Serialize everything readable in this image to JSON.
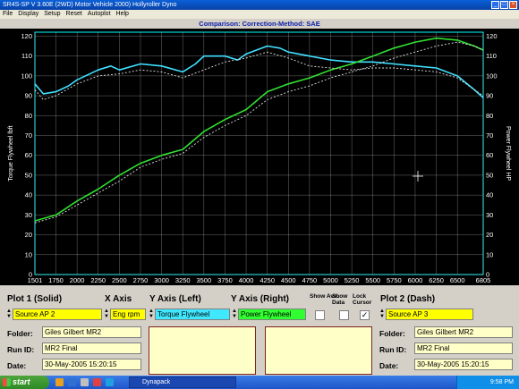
{
  "window": {
    "title": "SR4S-SP V 3.60E  (2WD)  Motor Vehicle 2000)  Hollyroller Dyno",
    "controls": [
      "_",
      "□",
      "×"
    ]
  },
  "menu": [
    "File",
    "Display",
    "Setup",
    "Reset",
    "Autoplot",
    "Help"
  ],
  "comparison_banner": "Comparison:    Correction-Method: SAE",
  "chart_data": {
    "type": "line",
    "xlabel": "",
    "ylabel_left": "Torque Flywheel lbft",
    "ylabel_right": "Power Flywheel HP",
    "x_ticks": [
      "1501",
      "1750",
      "2000",
      "2250",
      "2500",
      "2750",
      "3000",
      "3250",
      "3500",
      "3750",
      "4000",
      "4250",
      "4500",
      "4750",
      "5000",
      "5250",
      "5500",
      "5750",
      "6000",
      "6250",
      "6500",
      "6805"
    ],
    "y_ticks": [
      0,
      10,
      20,
      30,
      40,
      50,
      60,
      70,
      80,
      90,
      100,
      110,
      120
    ],
    "xlim": [
      1501,
      6805
    ],
    "ylim": [
      0,
      122
    ],
    "grid": true,
    "colors": {
      "torque": "#40e0ff",
      "power": "#30e030",
      "dash": "#e0e0e0",
      "grid": "#c8c8c8",
      "axis_frame": "#00ffff"
    },
    "series": [
      {
        "name": "Torque Flywheel",
        "style": "solid",
        "x": [
          1501,
          1600,
          1750,
          1900,
          2000,
          2250,
          2400,
          2500,
          2750,
          3000,
          3250,
          3400,
          3500,
          3750,
          3900,
          4000,
          4250,
          4400,
          4500,
          4750,
          5000,
          5250,
          5500,
          5750,
          6000,
          6250,
          6500,
          6700,
          6805
        ],
        "y": [
          96,
          91,
          92,
          95,
          98,
          103,
          105,
          103,
          106,
          105,
          102,
          106,
          110,
          110,
          108,
          111,
          115,
          114,
          112,
          110,
          108,
          107,
          107,
          106,
          105,
          104,
          100,
          93,
          89
        ]
      },
      {
        "name": "Power Flywheel",
        "style": "solid",
        "x": [
          1501,
          1750,
          2000,
          2250,
          2500,
          2750,
          3000,
          3250,
          3500,
          3750,
          4000,
          4250,
          4500,
          4750,
          5000,
          5250,
          5500,
          5750,
          6000,
          6250,
          6500,
          6700,
          6805
        ],
        "y": [
          27,
          30,
          37,
          43,
          50,
          56,
          60,
          63,
          72,
          78,
          83,
          92,
          96,
          99,
          103,
          106,
          110,
          114,
          117,
          119,
          118,
          115,
          113
        ]
      },
      {
        "name": "Torque Flywheel (Plot 2)",
        "style": "dash",
        "x": [
          1501,
          1600,
          1750,
          2000,
          2250,
          2500,
          2750,
          3000,
          3250,
          3500,
          3750,
          4000,
          4250,
          4500,
          4750,
          5000,
          5250,
          5500,
          5750,
          6000,
          6250,
          6500,
          6700,
          6805
        ],
        "y": [
          93,
          88,
          90,
          96,
          100,
          101,
          103,
          102,
          99,
          103,
          107,
          109,
          112,
          109,
          105,
          104,
          103,
          104,
          104,
          103,
          102,
          99,
          93,
          90
        ]
      },
      {
        "name": "Power Flywheel (Plot 2)",
        "style": "dash",
        "x": [
          1501,
          1750,
          2000,
          2250,
          2500,
          2750,
          3000,
          3250,
          3500,
          3750,
          4000,
          4250,
          4500,
          4750,
          5000,
          5250,
          5500,
          5750,
          6000,
          6250,
          6500,
          6700,
          6805
        ],
        "y": [
          26,
          29,
          35,
          41,
          47,
          54,
          58,
          61,
          69,
          75,
          80,
          88,
          92,
          95,
          99,
          102,
          105,
          109,
          112,
          115,
          117,
          115,
          113
        ]
      }
    ]
  },
  "panel": {
    "plot1_title": "Plot 1 (Solid)",
    "xaxis_title": "X Axis",
    "yleft_title": "Y Axis (Left)",
    "yright_title": "Y Axis (Right)",
    "show_ave": "Show Ave.",
    "show_data": "Show Data",
    "lock_cursor": "Lock Cursor",
    "plot2_title": "Plot 2 (Dash)",
    "plot1_source": "Source AP 2",
    "xaxis_value": "Eng rpm",
    "yleft_value": "Torque Flywheel",
    "yright_value": "Power Flywheel",
    "plot2_source": "Source AP 3",
    "folder_label": "Folder:",
    "runid_label": "Run ID:",
    "date_label": "Date:",
    "plot1_folder": "Giles Gilbert MR2",
    "plot1_runid": "MR2 Final",
    "plot1_date": "30-May-2005  15:20:15",
    "plot2_folder": "Giles Gilbert MR2",
    "plot2_runid": "MR2 Final",
    "plot2_date": "30-May-2005  15:20:15",
    "lock_cursor_checked": "✓"
  },
  "taskbar": {
    "start_label": "start",
    "task_label": "Dynapack",
    "clock": "9:58 PM"
  }
}
